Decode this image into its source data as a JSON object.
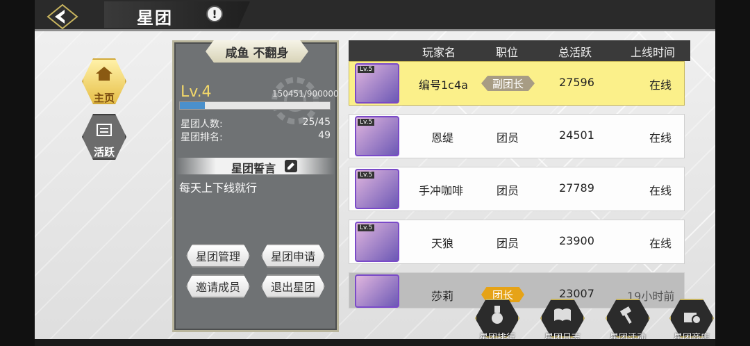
{
  "header": {
    "title": "星团",
    "info_symbol": "!"
  },
  "nav": [
    {
      "label": "主页",
      "active": true,
      "icon": "guild-home-icon"
    },
    {
      "label": "活跃",
      "active": false,
      "icon": "activity-icon"
    }
  ],
  "guild": {
    "name": "咸鱼 不翻身",
    "level": "Lv.4",
    "exp_text": "150451/900000",
    "exp_progress": 0.167,
    "members_label": "星团人数:",
    "members_value": "25/45",
    "rank_label": "星团排名:",
    "rank_value": "49",
    "motto_title": "星团誓言",
    "motto_text": "每天上下线就行",
    "buttons": {
      "manage": "星团管理",
      "apply": "星团申请",
      "invite": "邀请成员",
      "quit": "退出星团"
    }
  },
  "table": {
    "headers": {
      "player": "玩家名",
      "role": "职位",
      "activity": "总活跃",
      "online": "上线时间"
    },
    "rows": [
      {
        "lv": "Lv.5",
        "name": "编号1c4a",
        "role": "副团长",
        "activity": "27596",
        "online": "在线"
      },
      {
        "lv": "Lv.5",
        "name": "恩缇",
        "role": "团员",
        "activity": "24501",
        "online": "在线"
      },
      {
        "lv": "Lv.5",
        "name": "手冲咖啡",
        "role": "团员",
        "activity": "27789",
        "online": "在线"
      },
      {
        "lv": "Lv.5",
        "name": "天狼",
        "role": "团员",
        "activity": "23900",
        "online": "在线"
      },
      {
        "lv": "",
        "name": "莎莉",
        "role": "团长",
        "activity": "23007",
        "online": "19小时前"
      }
    ]
  },
  "bottom": [
    {
      "label": "星团排行",
      "icon": "ranking-medal-icon"
    },
    {
      "label": "星团日志",
      "icon": "log-book-icon"
    },
    {
      "label": "星团活动",
      "icon": "activity-hammer-icon"
    },
    {
      "label": "星团商店",
      "icon": "shop-bag-icon"
    }
  ],
  "colors": {
    "accent_gold": "#f3d86a",
    "vice_badge": "#a79c84",
    "leader_badge": "#e6a317",
    "highlight_row": "#fbf08a"
  }
}
